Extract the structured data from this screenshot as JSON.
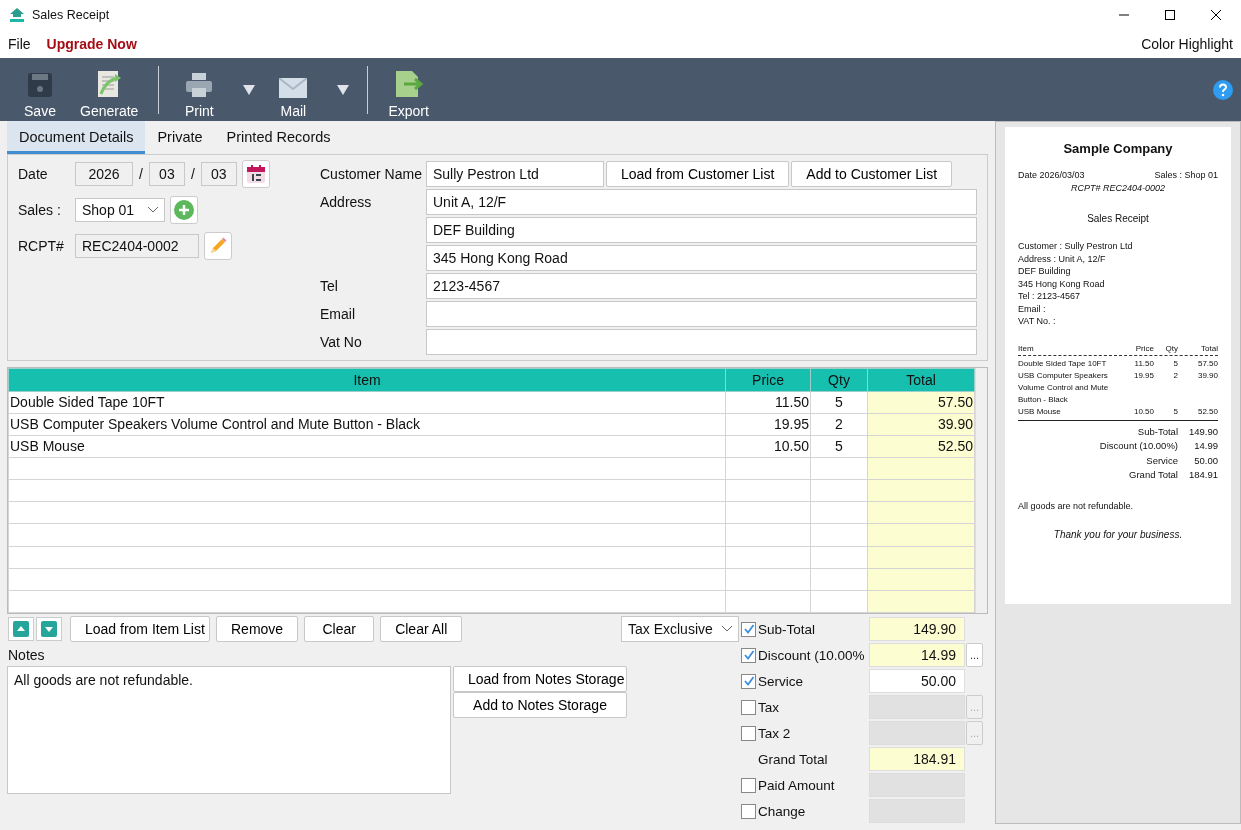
{
  "window": {
    "title": "Sales Receipt"
  },
  "menu": [
    {
      "label": "File",
      "kind": "plain"
    },
    {
      "label": "Upgrade Now",
      "kind": "promo"
    }
  ],
  "menu_right": "Color Highlight",
  "toolbar": [
    {
      "label": "Save",
      "kind": "save",
      "dropdown": false,
      "separator_after": false
    },
    {
      "label": "Generate",
      "kind": "generate",
      "dropdown": false,
      "separator_after": true
    },
    {
      "label": "Print",
      "kind": "print",
      "dropdown": true,
      "separator_after": false
    },
    {
      "label": "Mail",
      "kind": "mail",
      "dropdown": true,
      "separator_after": true
    },
    {
      "label": "Export",
      "kind": "export",
      "dropdown": false,
      "separator_after": false
    }
  ],
  "tabs": [
    {
      "label": "Document Details",
      "selected": true
    },
    {
      "label": "Private",
      "selected": false
    },
    {
      "label": "Printed Records",
      "selected": false
    }
  ],
  "date": {
    "label": "Date",
    "parts": [
      "2026",
      "03",
      "03"
    ],
    "separators": [
      "/",
      "/"
    ]
  },
  "sales": {
    "label": "Sales :",
    "value": "Shop 01"
  },
  "rcpt": {
    "label": "RCPT#",
    "value": "REC2404-0002"
  },
  "customer_fields": [
    {
      "label": "Customer Name",
      "value": "Sully Pestron Ltd"
    },
    {
      "label": "Address",
      "value": "Unit A, 12/F"
    },
    {
      "value": "DEF Building"
    },
    {
      "value": "345 Hong Kong Road"
    },
    {
      "label": "Tel",
      "value": "2123-4567"
    },
    {
      "label": "Email"
    },
    {
      "label": "Vat No"
    }
  ],
  "customer_buttons": [
    "Load from Customer List",
    "Add to Customer List"
  ],
  "table": {
    "columns": [
      "Item",
      "Price",
      "Qty",
      "Total"
    ],
    "rows": [
      [
        "Double Sided Tape 10FT",
        "11.50",
        "5",
        "57.50"
      ],
      [
        "USB Computer Speakers Volume Control and Mute Button - Black",
        "19.95",
        "2",
        "39.90"
      ],
      [
        "USB Mouse",
        "10.50",
        "5",
        "52.50"
      ]
    ]
  },
  "item_buttons": [
    "Load from Item List",
    "Remove",
    "Clear",
    "Clear All"
  ],
  "notes": {
    "label": "Notes",
    "value": "All goods are not refundable.",
    "buttons": [
      "Load from Notes Storage",
      "Add to Notes Storage"
    ]
  },
  "tax_mode": "Tax Exclusive",
  "totals": [
    {
      "label": "Sub-Total",
      "kind": "check",
      "checked": true,
      "value": "149.90",
      "highlighted": true,
      "disabled": false
    },
    {
      "label": "Discount (10.00%",
      "kind": "check",
      "checked": true,
      "value": "14.99",
      "highlighted": true,
      "disabled": false,
      "more": {
        "label": "...",
        "disabled": false
      }
    },
    {
      "label": "Service",
      "kind": "check",
      "checked": true,
      "value": "50.00",
      "highlighted": false,
      "disabled": false
    },
    {
      "label": "Tax",
      "kind": "check",
      "checked": false,
      "highlighted": false,
      "disabled": true,
      "more": {
        "label": "...",
        "disabled": true
      }
    },
    {
      "label": "Tax 2",
      "kind": "check",
      "checked": false,
      "highlighted": false,
      "disabled": true,
      "more": {
        "label": "...",
        "disabled": true
      }
    },
    {
      "label": "Grand Total",
      "kind": "plain",
      "value": "184.91",
      "highlighted": true,
      "disabled": false
    },
    {
      "label": "Paid Amount",
      "kind": "check",
      "checked": false,
      "highlighted": false,
      "disabled": true
    },
    {
      "label": "Change",
      "kind": "check",
      "checked": false,
      "highlighted": false,
      "disabled": true
    }
  ],
  "receipt": {
    "company": "Sample Company",
    "date_line": "Date 2026/03/03",
    "sales_line": "Sales : Shop 01",
    "rcpt_line": "RCPT# REC2404-0002",
    "title": "Sales Receipt",
    "info": [
      "Customer : Sully Pestron Ltd",
      "Address : Unit A, 12/F",
      "DEF Building",
      "345 Hong Kong Road",
      "Tel : 2123-4567",
      "Email :",
      "VAT No. :"
    ],
    "columns": [
      "Item",
      "Price",
      "Qty",
      "Total"
    ],
    "rows": [
      [
        "Double Sided Tape 10FT",
        "11.50",
        "5",
        "57.50"
      ],
      [
        "USB Computer Speakers Volume Control and Mute Button - Black",
        "19.95",
        "2",
        "39.90"
      ],
      [
        "USB Mouse",
        "10.50",
        "5",
        "52.50"
      ]
    ],
    "summary": [
      {
        "label": "Sub-Total",
        "value": "149.90"
      },
      {
        "label": "Discount (10.00%)",
        "value": "14.99"
      },
      {
        "label": "Service",
        "value": "50.00"
      },
      {
        "label": "Grand Total",
        "value": "184.91"
      }
    ],
    "note": "All goods are not refundable.",
    "thanks": "Thank you for your business."
  }
}
